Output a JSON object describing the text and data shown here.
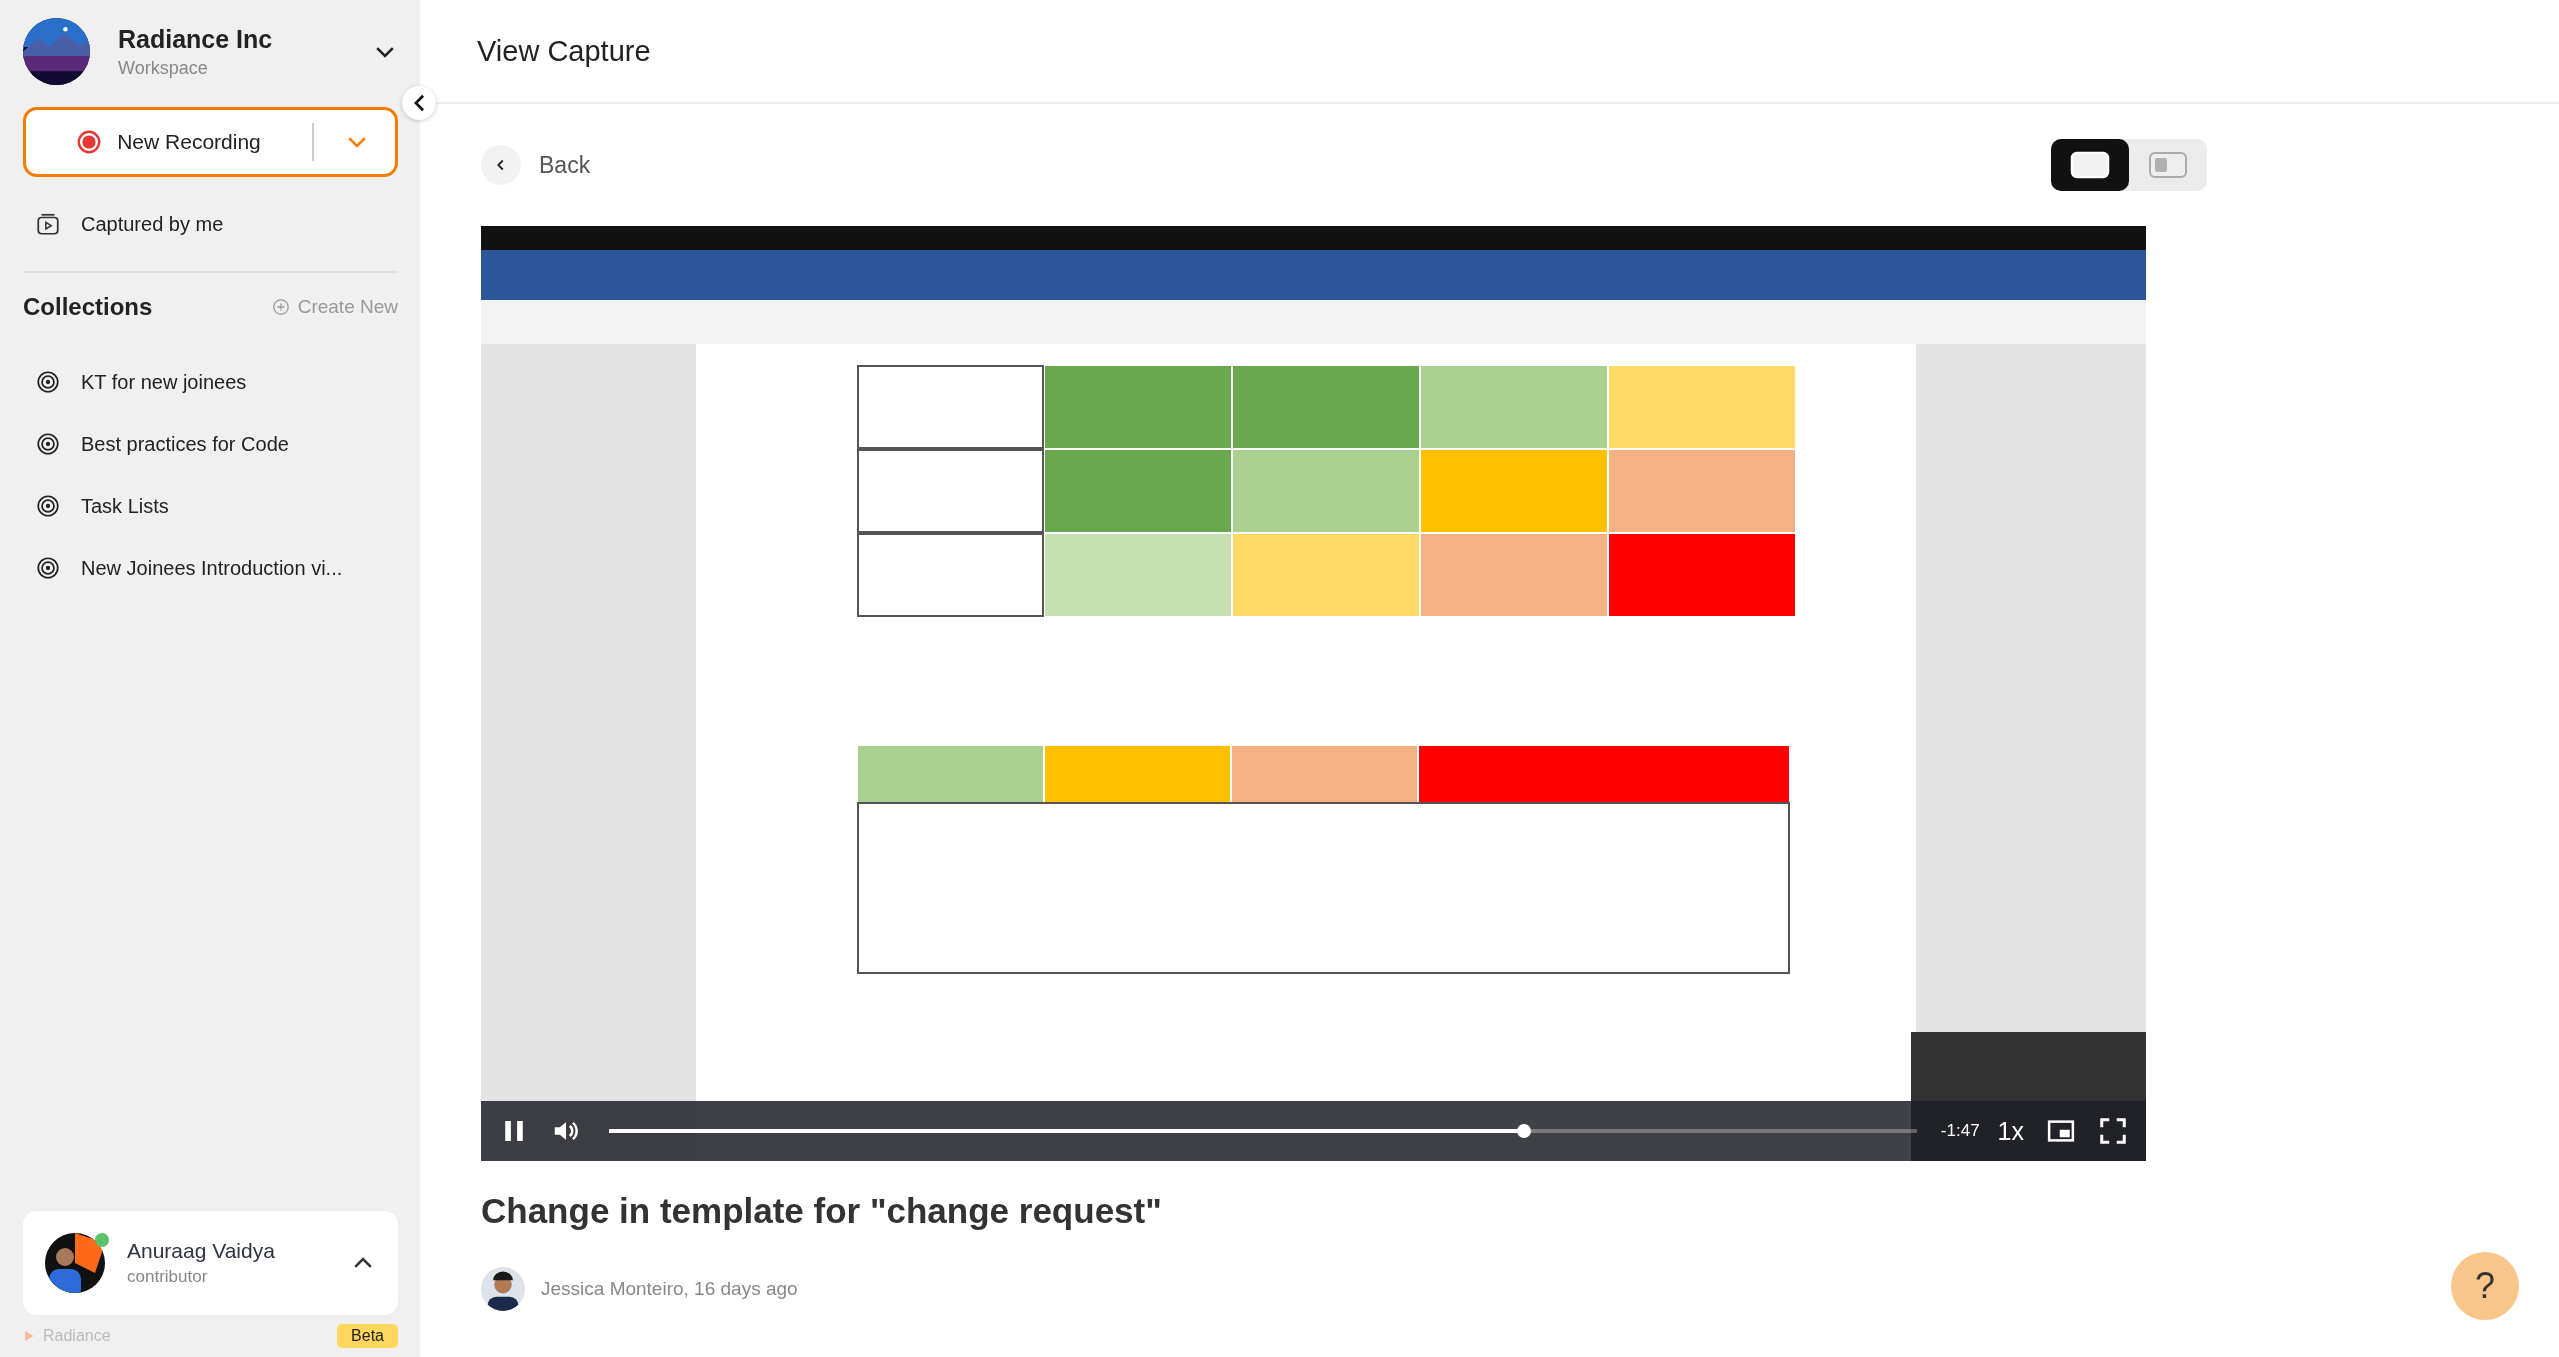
{
  "header": {
    "title": "View Capture"
  },
  "sidebar": {
    "workspace": {
      "name": "Radiance Inc",
      "subtitle": "Workspace"
    },
    "new_recording": {
      "label": "New Recording"
    },
    "nav_items": [
      {
        "label": "Captured by me"
      }
    ],
    "collections": {
      "title": "Collections",
      "create_label": "Create New",
      "items": [
        {
          "label": "KT for new joinees"
        },
        {
          "label": "Best practices for Code"
        },
        {
          "label": "Task Lists"
        },
        {
          "label": "New Joinees Introduction vi..."
        }
      ]
    },
    "user": {
      "name": "Anuraag Vaidya",
      "role": "contributor",
      "online": true
    },
    "brand": "Radiance",
    "badge": "Beta"
  },
  "back": {
    "label": "Back"
  },
  "view_toggle": [
    {
      "kind": "full",
      "selected": true
    },
    {
      "kind": "split",
      "selected": false
    }
  ],
  "player": {
    "playing": true,
    "level": 0.7,
    "time": "-1:47",
    "speed": "1x"
  },
  "capture": {
    "title": "Change in template for \"change request\"",
    "meta": "Jessica Monteiro, 16 days ago"
  },
  "help": {
    "label": "?"
  }
}
